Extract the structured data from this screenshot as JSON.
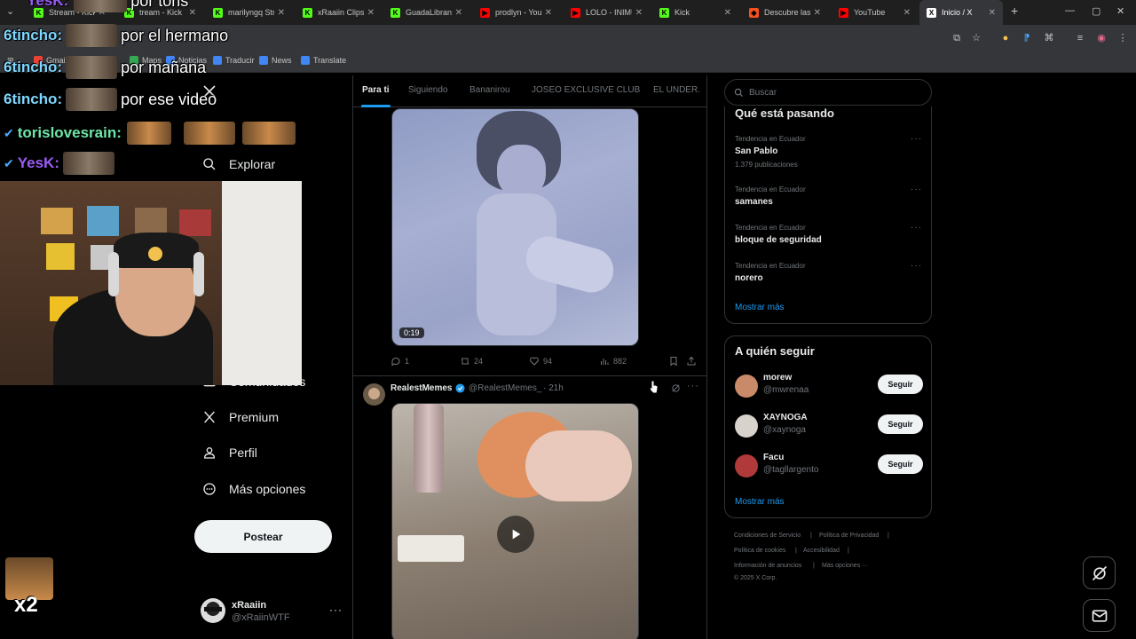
{
  "browser": {
    "tabs": [
      {
        "label": "Stream - Kick",
        "favicon_color": "#53fc18",
        "favicon_glyph": "K"
      },
      {
        "label": "tream - Kick",
        "favicon_color": "#53fc18",
        "favicon_glyph": "K"
      },
      {
        "label": "marilyngq Strea",
        "favicon_color": "#53fc18",
        "favicon_glyph": "K"
      },
      {
        "label": "xRaaiin Clips -",
        "favicon_color": "#53fc18",
        "favicon_glyph": "K"
      },
      {
        "label": "GuadaLibrandi",
        "favicon_color": "#53fc18",
        "favicon_glyph": "K"
      },
      {
        "label": "prodlyn - YouTu",
        "favicon_color": "#ff0000",
        "favicon_glyph": "▶"
      },
      {
        "label": "LOLO - INIMU",
        "favicon_color": "#ff0000",
        "favicon_glyph": "▶"
      },
      {
        "label": "Kick",
        "favicon_color": "#53fc18",
        "favicon_glyph": "K"
      },
      {
        "label": "Descubre las c",
        "favicon_color": "#f4511e",
        "favicon_glyph": "◆"
      },
      {
        "label": "YouTube",
        "favicon_color": "#ff0000",
        "favicon_glyph": "▶"
      },
      {
        "label": "Inicio / X",
        "favicon_color": "#ffffff",
        "favicon_glyph": "X",
        "active": true
      }
    ],
    "bookmarks": [
      {
        "label": "Gmail",
        "color": "#ea4335"
      },
      {
        "label": "Maps",
        "color": "#34a853"
      },
      {
        "label": "Noticias",
        "color": "#4285f4"
      },
      {
        "label": "Traducir",
        "color": "#4285f4"
      },
      {
        "label": "News",
        "color": "#4285f4"
      },
      {
        "label": "Translate",
        "color": "#4285f4"
      }
    ]
  },
  "nav": {
    "explore_label": "Explorar",
    "communities_label": "Comunidades",
    "premium_label": "Premium",
    "profile_label": "Perfil",
    "more_label": "Más opciones",
    "post_button": "Postear"
  },
  "account": {
    "name": "xRaaiin",
    "handle": "@xRaiinWTF"
  },
  "feed": {
    "tabs": [
      "Para ti",
      "Siguiendo",
      "Bananirou",
      "JOSEO EXCLUSIVE CLUB",
      "EL UNDER."
    ],
    "post1": {
      "video_duration": "0:19",
      "replies": "1",
      "reposts": "24",
      "likes": "94",
      "views": "882"
    },
    "post2": {
      "author": "RealestMemes",
      "handle": "@RealestMemes_",
      "time": "· 21h"
    }
  },
  "sidebar": {
    "search_placeholder": "Buscar",
    "trends_title": "Qué está pasando",
    "trends": [
      {
        "context": "Tendencia en Ecuador",
        "name": "San Pablo",
        "count": "1.379 publicaciones"
      },
      {
        "context": "Tendencia en Ecuador",
        "name": "samanes"
      },
      {
        "context": "Tendencia en Ecuador",
        "name": "bloque de seguridad"
      },
      {
        "context": "Tendencia en Ecuador",
        "name": "norero"
      }
    ],
    "trends_show_more": "Mostrar más",
    "who_to_follow_title": "A quién seguir",
    "who_to_follow": [
      {
        "name": "morew",
        "handle": "@mwrenaa",
        "button": "Seguir",
        "avatar_color": "#c98a6a"
      },
      {
        "name": "XAYNOGA",
        "handle": "@xaynoga",
        "button": "Seguir",
        "avatar_color": "#d8d2cc"
      },
      {
        "name": "Facu",
        "handle": "@tagllargento",
        "button": "Seguir",
        "avatar_color": "#b03a3a"
      }
    ],
    "wtf_show_more": "Mostrar más",
    "footer": [
      "Condiciones de Servicio",
      "Política de Privacidad",
      "Política de cookies",
      "Accesibilidad",
      "Información de anuncios",
      "Más opciones ···",
      "© 2025 X Corp."
    ]
  },
  "overlay": {
    "chat": [
      {
        "user": "YesK:",
        "message": "por toris",
        "color": "#9b5cf6"
      },
      {
        "user": "6tincho:",
        "message": "por el hermano",
        "color": "#7fd7ff"
      },
      {
        "user": "6tincho:",
        "message": "por mañana",
        "color": "#7fd7ff"
      },
      {
        "user": "6tincho:",
        "message": "por ese video",
        "color": "#7fd7ff"
      },
      {
        "user": "torislovesrain:",
        "message": "",
        "color": "#6ee7a8"
      },
      {
        "user": "YesK:",
        "message": "",
        "color": "#9b5cf6"
      }
    ],
    "multiplier": "x2"
  }
}
